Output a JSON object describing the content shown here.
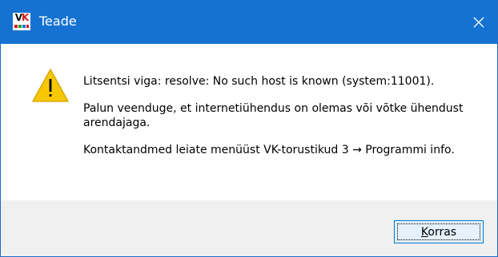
{
  "window": {
    "title": "Teade",
    "app_icon": {
      "name": "vk-app-icon",
      "text_v": "V",
      "text_k": "K"
    }
  },
  "titlebar": {
    "close_icon": "close-icon",
    "background": "#1672d2"
  },
  "message": {
    "icon": "warning-icon",
    "icon_color": "#f7c800",
    "lines": [
      "Litsentsi viga: resolve: No such host is known (system:11001).",
      "Palun veenduge, et internetiühendus on olemas või võtke ühendust arendajaga.",
      "Kontaktandmed leiate menüüst VK-torustikud 3 → Programmi info."
    ]
  },
  "footer": {
    "ok_button": {
      "accel": "K",
      "rest": "orras"
    }
  }
}
